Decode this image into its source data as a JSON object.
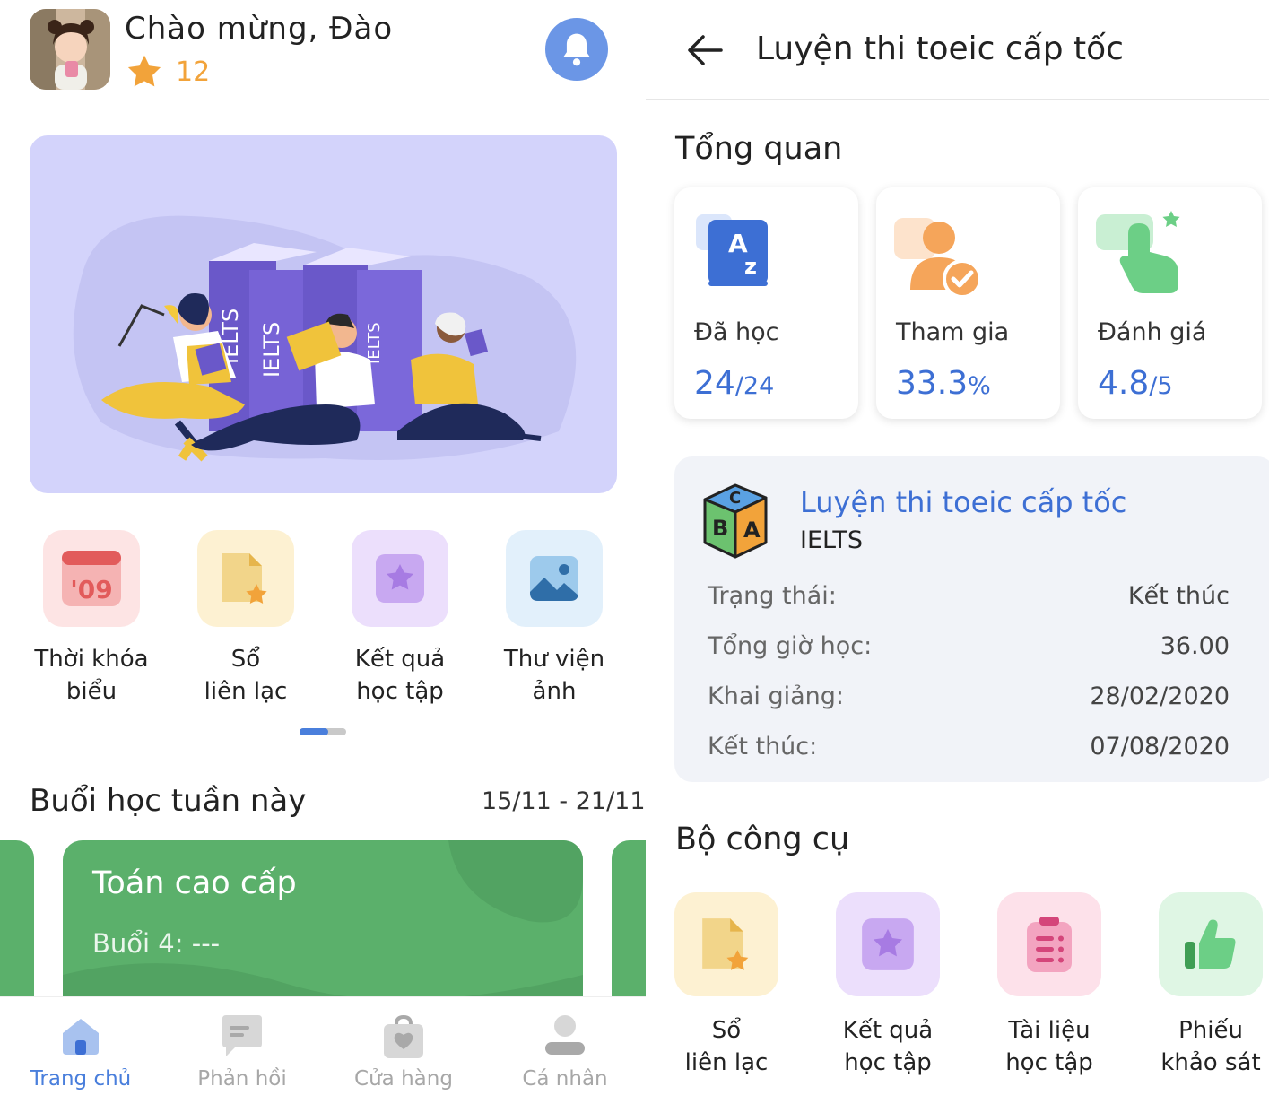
{
  "home": {
    "greeting": "Chào mừng, Đào",
    "points": "12",
    "quick_actions": [
      {
        "label": "Thời khóa\nbiểu",
        "icon": "calendar-icon"
      },
      {
        "label": "Sổ\nliên lạc",
        "icon": "notebook-icon"
      },
      {
        "label": "Kết quả\nhọc tập",
        "icon": "star-badge-icon"
      },
      {
        "label": "Thư viện\nảnh",
        "icon": "gallery-icon"
      }
    ],
    "calendar_icon_text": "'09",
    "banner_book_text": "IELTS",
    "week": {
      "title": "Buổi học tuần này",
      "range": "15/11 - 21/11"
    },
    "class_card": {
      "title": "Toán cao cấp",
      "session": "Buổi 4: ---"
    },
    "nav": [
      {
        "label": "Trang chủ",
        "icon": "home-icon",
        "active": true
      },
      {
        "label": "Phản hồi",
        "icon": "chat-icon",
        "active": false
      },
      {
        "label": "Cửa hàng",
        "icon": "shop-bag-icon",
        "active": false
      },
      {
        "label": "Cá nhân",
        "icon": "profile-icon",
        "active": false
      }
    ]
  },
  "course": {
    "title": "Luyện thi toeic cấp tốc",
    "overview_title": "Tổng quan",
    "stats": [
      {
        "label": "Đã học",
        "value": "24",
        "suffix": "/24",
        "icon": "az-book-icon"
      },
      {
        "label": "Tham gia",
        "value": "33.3",
        "suffix": "%",
        "icon": "user-check-icon"
      },
      {
        "label": "Đánh giá",
        "value": "4.8",
        "suffix": "/5",
        "icon": "tap-star-icon"
      }
    ],
    "info": {
      "name": "Luyện thi toeic cấp tốc",
      "category": "IELTS",
      "rows": [
        {
          "label": "Trạng thái:",
          "value": "Kết thúc"
        },
        {
          "label": "Tổng giờ học:",
          "value": "36.00"
        },
        {
          "label": "Khai giảng:",
          "value": "28/02/2020"
        },
        {
          "label": "Kết thúc:",
          "value": "07/08/2020"
        }
      ]
    },
    "tools_title": "Bộ công cụ",
    "tools": [
      {
        "label": "Sổ\nliên lạc",
        "icon": "notebook-icon"
      },
      {
        "label": "Kết quả\nhọc tập",
        "icon": "star-badge-icon"
      },
      {
        "label": "Tài liệu\nhọc tập",
        "icon": "clipboard-list-icon"
      },
      {
        "label": "Phiếu\nkhảo sát",
        "icon": "thumbs-up-icon"
      }
    ]
  },
  "colors": {
    "accent": "#3d6fd4",
    "class_card": "#5bb06b",
    "banner": "#d3d3fb",
    "star": "#f2a33a"
  }
}
